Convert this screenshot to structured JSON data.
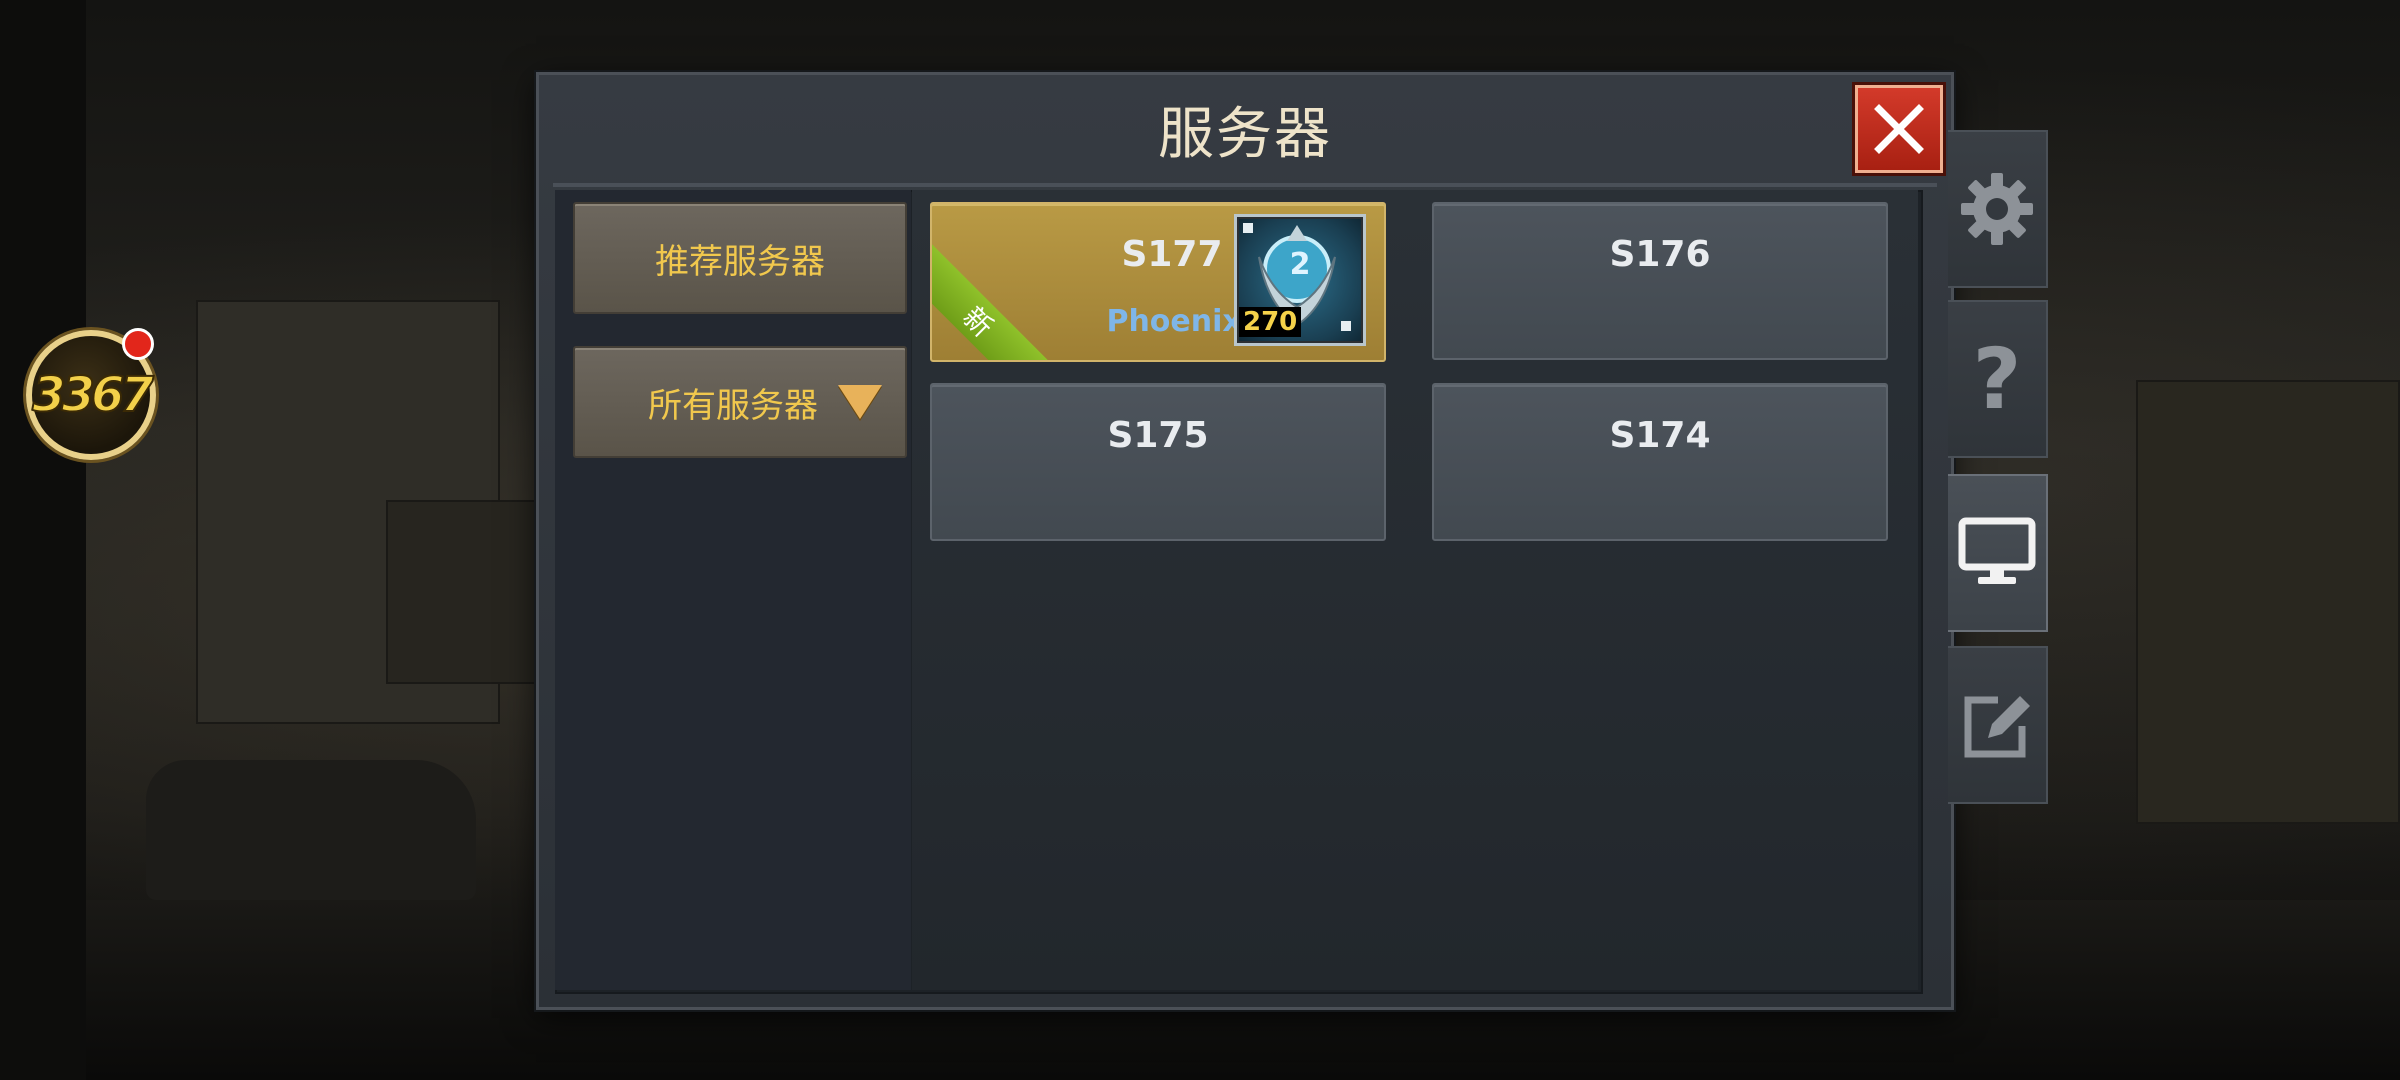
{
  "overlay_badge": {
    "text": "3367"
  },
  "dialog": {
    "title": "服务器",
    "tabs": [
      {
        "label": "推荐服务器"
      },
      {
        "label": "所有服务器"
      }
    ],
    "servers": [
      {
        "name": "S177",
        "new_tag": "新",
        "player_name": "Phoenixa",
        "rank_level": "2",
        "rank_count": "270"
      },
      {
        "name": "S176"
      },
      {
        "name": "S175"
      },
      {
        "name": "S174"
      }
    ]
  },
  "side_menu": {
    "items": [
      {
        "icon": "gear-icon"
      },
      {
        "icon": "question-icon",
        "glyph": "?"
      },
      {
        "icon": "monitor-icon"
      },
      {
        "icon": "edit-icon"
      }
    ]
  },
  "colors": {
    "accent_gold": "#f1c84d",
    "close_red": "#c0301f",
    "selected_server": "#b99a45",
    "new_ribbon": "#8fc12a"
  }
}
